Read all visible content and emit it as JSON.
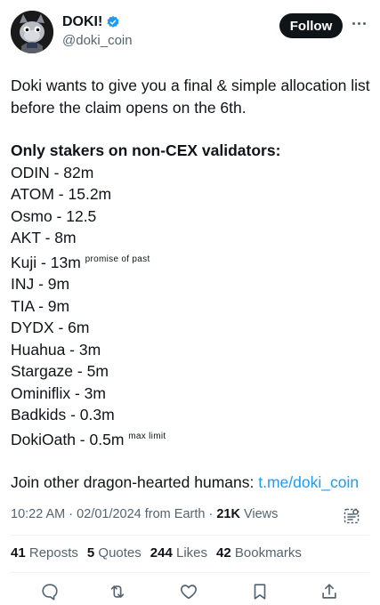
{
  "author": {
    "display_name": "DOKI!",
    "handle": "@doki_coin",
    "verified": true
  },
  "follow_label": "Follow",
  "tweet": {
    "intro": "Doki wants to give you a final & simple allocation list before the claim opens on the 6th.",
    "heading": "Only stakers on non-CEX validators:",
    "allocations": [
      {
        "text": "ODIN - 82m",
        "note": ""
      },
      {
        "text": "ATOM - 15.2m",
        "note": ""
      },
      {
        "text": "Osmo - 12.5",
        "note": ""
      },
      {
        "text": "AKT - 8m",
        "note": ""
      },
      {
        "text": "Kuji - 13m",
        "note": "promise of past"
      },
      {
        "text": "INJ - 9m",
        "note": ""
      },
      {
        "text": "TIA - 9m",
        "note": ""
      },
      {
        "text": "DYDX - 6m",
        "note": ""
      },
      {
        "text": "Huahua - 3m",
        "note": ""
      },
      {
        "text": "Stargaze - 5m",
        "note": ""
      },
      {
        "text": "Ominiflix - 3m",
        "note": ""
      },
      {
        "text": "Badkids - 0.3m",
        "note": ""
      },
      {
        "text": "DokiOath - 0.5m",
        "note": "max limit"
      }
    ],
    "cta_text": "Join other dragon-hearted humans: ",
    "cta_link": "t.me/doki_coin"
  },
  "meta": {
    "time": "10:22 AM",
    "sep1": " · ",
    "date": "02/01/2024",
    "source": " from Earth",
    "sep2": " · ",
    "views_count": "21K",
    "views_label": " Views"
  },
  "stats": {
    "reposts_count": "41",
    "reposts_label": "Reposts",
    "quotes_count": "5",
    "quotes_label": "Quotes",
    "likes_count": "244",
    "likes_label": "Likes",
    "bookmarks_count": "42",
    "bookmarks_label": "Bookmarks"
  },
  "colors": {
    "text": "#0f1419",
    "secondary": "#536471",
    "link": "#1d9bf0",
    "verified": "#1d9bf0",
    "follow_bg": "#0f1419"
  },
  "icons": [
    "verified-badge-icon",
    "more-icon",
    "grok-icon",
    "reply-icon",
    "repost-icon",
    "like-icon",
    "bookmark-icon",
    "share-icon"
  ]
}
